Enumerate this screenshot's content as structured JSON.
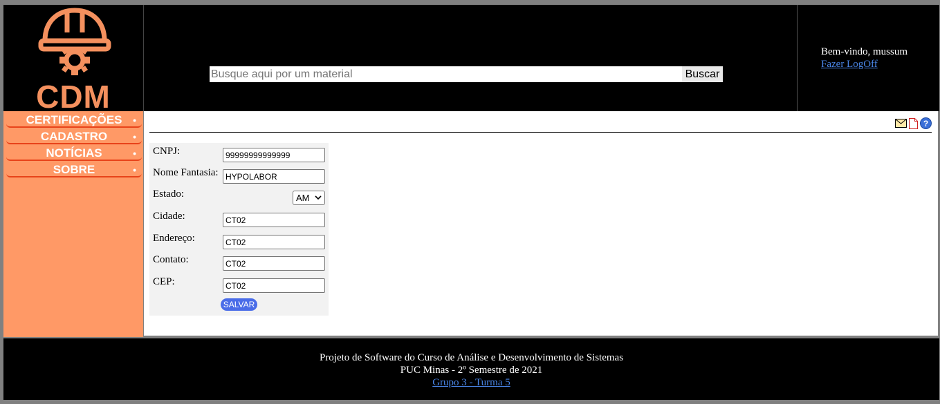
{
  "header": {
    "logo_text": "CDM",
    "search_placeholder": "Busque aqui por um material",
    "search_button": "Buscar",
    "welcome": "Bem-vindo, mussum",
    "logoff": "Fazer LogOff"
  },
  "sidebar": {
    "items": [
      {
        "label": "CERTIFICAÇÕES",
        "dot": "•"
      },
      {
        "label": "CADASTRO",
        "dot": "•"
      },
      {
        "label": "NOTÍCIAS",
        "dot": "•"
      },
      {
        "label": "SOBRE",
        "dot": "•"
      }
    ]
  },
  "toolbar": {
    "icons": [
      "mail-icon",
      "document-icon",
      "help-icon"
    ]
  },
  "form": {
    "cnpj_label": "CNPJ:",
    "cnpj_value": "99999999999999",
    "nome_label": "Nome Fantasia:",
    "nome_value": "HYPOLABOR",
    "estado_label": "Estado:",
    "estado_value": "AM",
    "cidade_label": "Cidade:",
    "cidade_value": "CT02",
    "endereco_label": "Endereço:",
    "endereco_value": "CT02",
    "contato_label": "Contato:",
    "contato_value": "CT02",
    "cep_label": "CEP:",
    "cep_value": "CT02",
    "save_label": "SALVAR"
  },
  "footer": {
    "line1": "Projeto de Software do Curso de Análise e Desenvolvimento de Sistemas",
    "line2": "PUC Minas - 2º Semestre de 2021",
    "link": "Grupo 3 - Turma 5"
  },
  "colors": {
    "accent": "#FF9966",
    "logo": "#F4905E",
    "link": "#4A86E8",
    "save": "#4A6CE8"
  }
}
